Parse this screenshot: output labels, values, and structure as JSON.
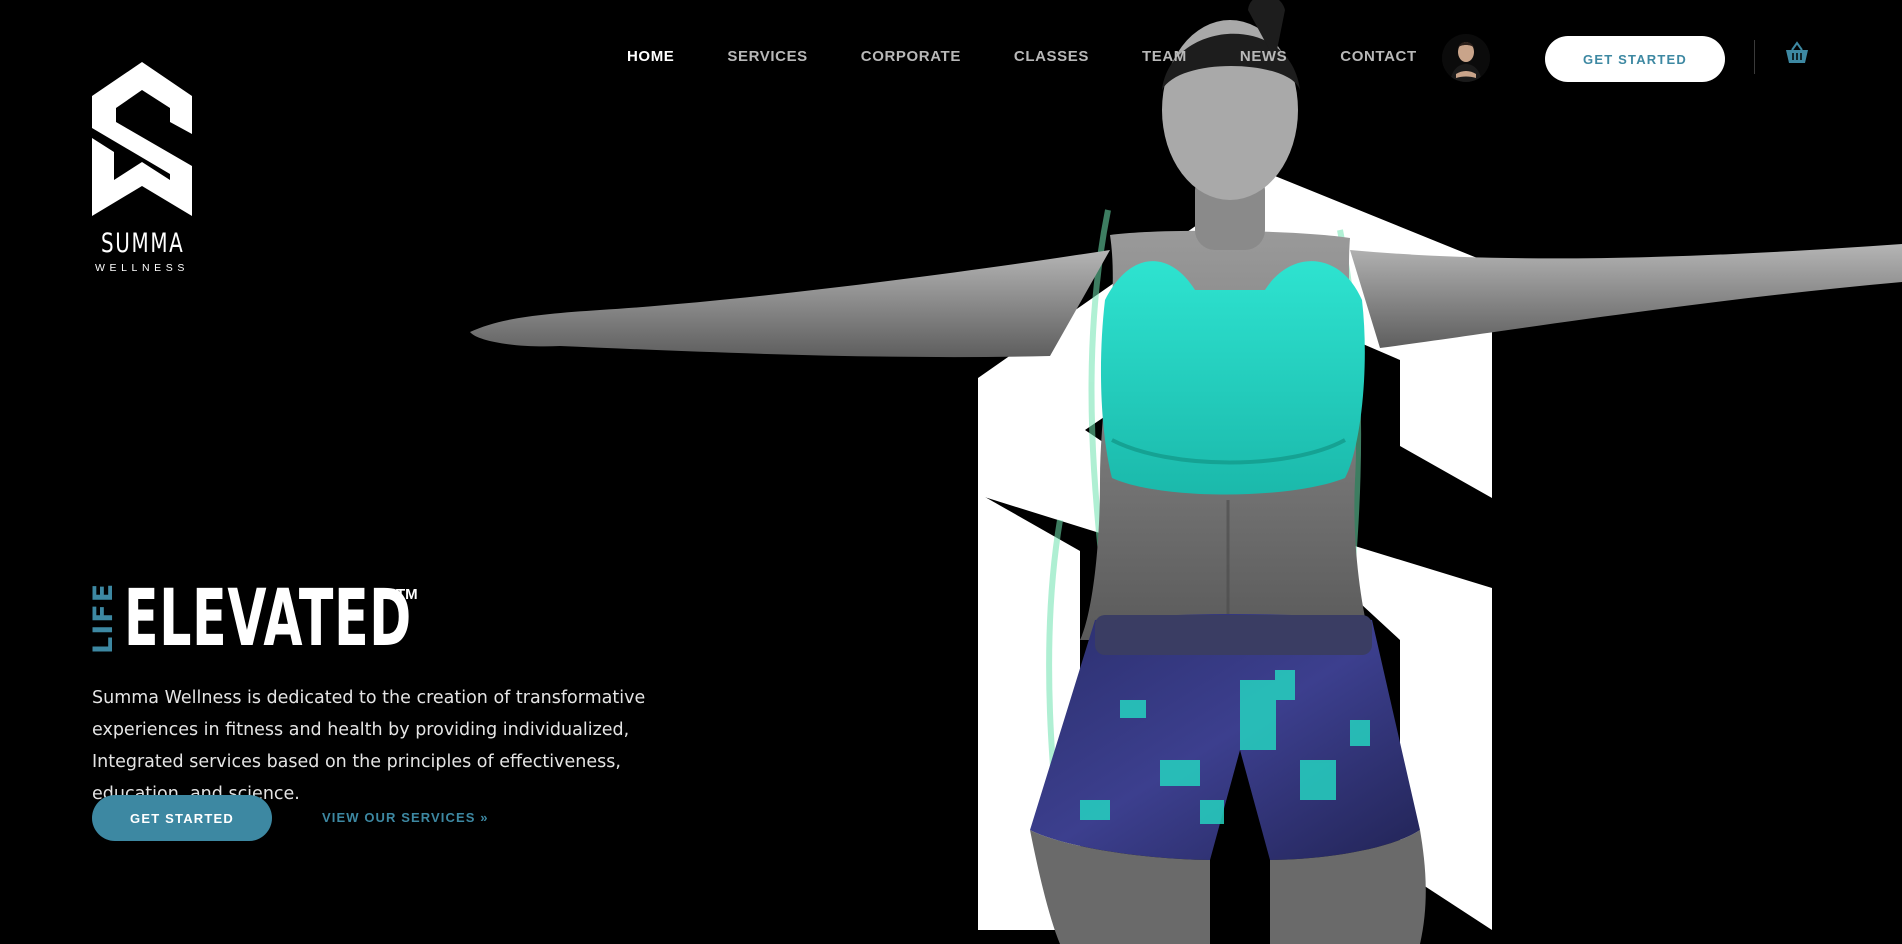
{
  "brand": {
    "name": "SUMMA",
    "tagline": "WELLNESS"
  },
  "nav": {
    "items": [
      {
        "label": "HOME",
        "active": true
      },
      {
        "label": "SERVICES",
        "active": false
      },
      {
        "label": "CORPORATE",
        "active": false
      },
      {
        "label": "CLASSES",
        "active": false
      },
      {
        "label": "TEAM",
        "active": false
      },
      {
        "label": "NEWS",
        "active": false
      },
      {
        "label": "CONTACT",
        "active": false
      }
    ],
    "cta_label": "GET STARTED",
    "cart_icon": "shopping-basket-icon",
    "avatar_icon": "user-avatar"
  },
  "hero": {
    "headline_prefix": "LIFE",
    "headline_main": "ELEVATED",
    "trademark": "TM",
    "description": "Summa Wellness is dedicated to the creation of transformative experiences in fitness and health by providing individualized, Integrated services based on the principles of effectiveness, education, and science.",
    "primary_cta": "GET STARTED",
    "secondary_link": "VIEW OUR SERVICES »"
  },
  "colors": {
    "background": "#000000",
    "accent": "#3d88a2",
    "bra": "#26d5c4",
    "text_muted": "#b8b8b8",
    "white": "#ffffff"
  }
}
